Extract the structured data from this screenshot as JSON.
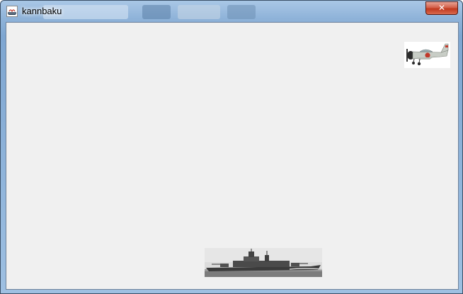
{
  "window": {
    "title": "kannbaku",
    "close_glyph": "✕",
    "icon": "java-app-icon"
  },
  "game": {
    "background_color": "#f0f0f0",
    "sprites": [
      {
        "name": "fighter-plane",
        "icon": "zero-fighter-sprite"
      },
      {
        "name": "battleship",
        "icon": "battleship-sprite"
      }
    ]
  }
}
